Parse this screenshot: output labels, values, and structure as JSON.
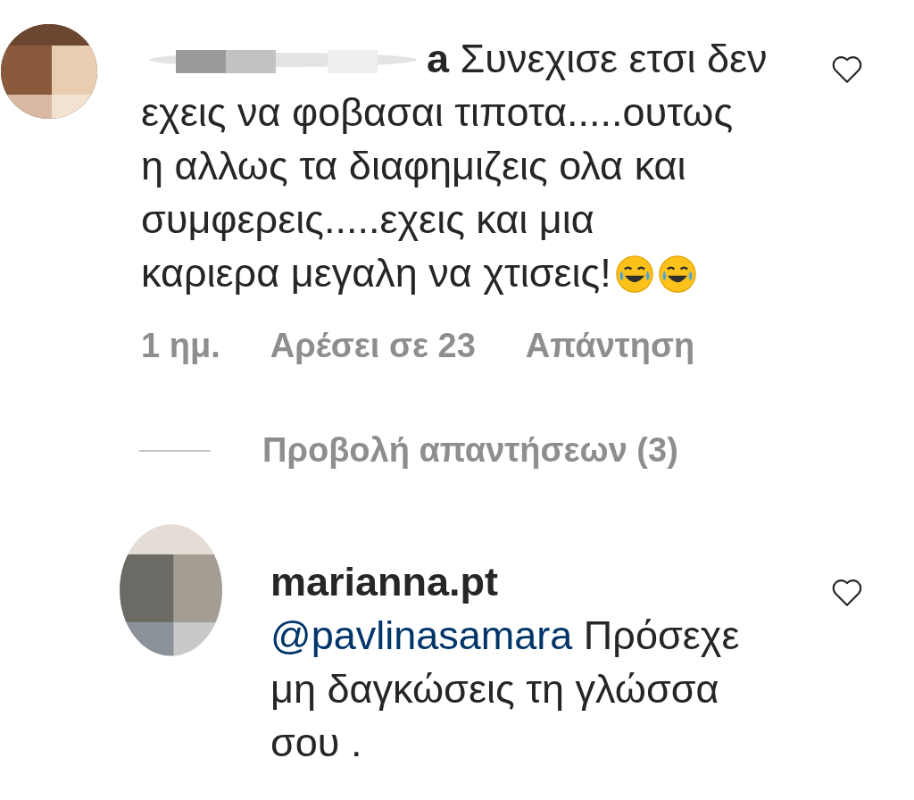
{
  "comments": [
    {
      "username": "a",
      "username_redacted": true,
      "lines": [
        "Συνεχισε ετσι δεν",
        "εχεις να φοβασαι τιποτα.....ουτως",
        "η αλλως τα διαφημιζεις ολα και",
        "συμφερεις.....εχεις και μια",
        "καριερα μεγαλη να χτισεις!"
      ],
      "emojis": [
        {
          "kind": "laughing"
        },
        {
          "kind": "laughing"
        }
      ],
      "liked": false,
      "meta": {
        "time": "1 ημ.",
        "likes": "Αρέσει σε 23",
        "reply": "Απάντηση"
      },
      "view_replies": "Προβολή απαντήσεων (3)"
    },
    {
      "username": "marianna.pt",
      "username_redacted": false,
      "mention": "@pavlinasamara",
      "lines": [
        "Πρόσεχε",
        "μη δαγκώσεις τη γλώσσα",
        "σου ."
      ],
      "liked": false
    }
  ]
}
